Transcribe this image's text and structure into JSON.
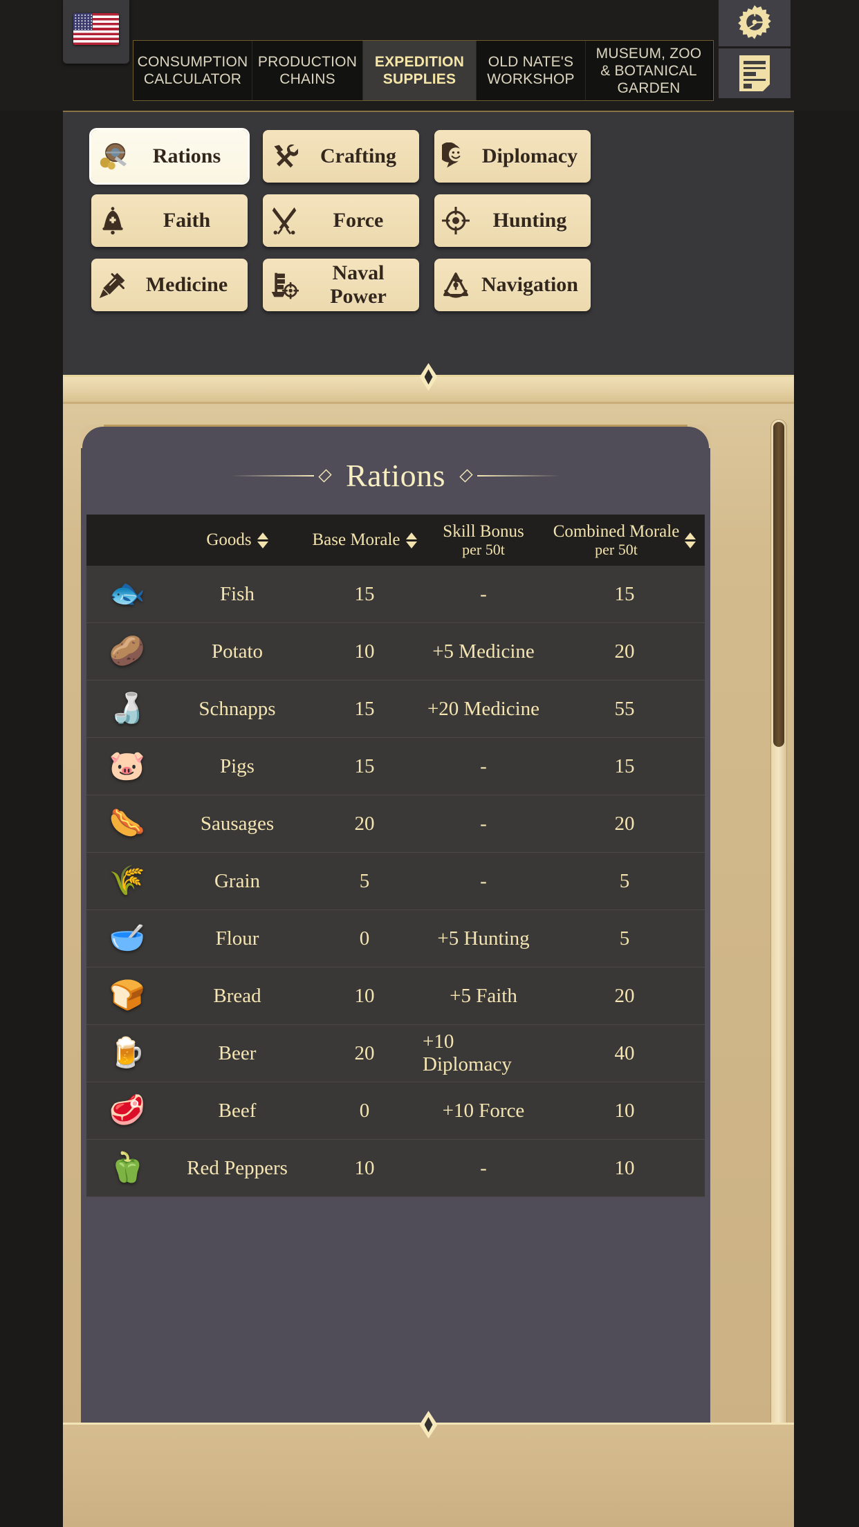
{
  "header": {
    "flag_icon": "us-flag-icon",
    "tabs": [
      {
        "label": "CONSUMPTION\nCALCULATOR",
        "line1": "CONSUMPTION",
        "line2": "CALCULATOR",
        "active": false
      },
      {
        "label": "PRODUCTION\nCHAINS",
        "line1": "PRODUCTION",
        "line2": "CHAINS",
        "active": false
      },
      {
        "label": "EXPEDITION\nSUPPLIES",
        "line1": "EXPEDITION",
        "line2": "SUPPLIES",
        "active": true
      },
      {
        "label": "OLD NATE'S\nWORKSHOP",
        "line1": "OLD NATE'S",
        "line2": "WORKSHOP",
        "active": false
      },
      {
        "label": "MUSEUM, ZOO\n& BOTANICAL\nGARDEN",
        "line1": "MUSEUM, ZOO",
        "line2": "& BOTANICAL",
        "line3": "GARDEN",
        "active": false
      }
    ],
    "system_buttons": [
      {
        "name": "settings-gear-icon"
      },
      {
        "name": "notes-document-icon"
      }
    ]
  },
  "categories": [
    {
      "label": "Rations",
      "icon": "barrel-rations-icon",
      "selected": true
    },
    {
      "label": "Crafting",
      "icon": "hammer-wrench-icon",
      "selected": false
    },
    {
      "label": "Diplomacy",
      "icon": "speech-smiley-icon",
      "selected": false
    },
    {
      "label": "Faith",
      "icon": "bell-icon",
      "selected": false
    },
    {
      "label": "Force",
      "icon": "crossed-swords-icon",
      "selected": false
    },
    {
      "label": "Hunting",
      "icon": "crosshair-icon",
      "selected": false
    },
    {
      "label": "Medicine",
      "icon": "syringe-icon",
      "selected": false
    },
    {
      "label": "Naval Power",
      "icon": "ship-target-icon",
      "selected": false
    },
    {
      "label": "Navigation",
      "icon": "sextant-icon",
      "selected": false
    }
  ],
  "panel": {
    "title": "Rations",
    "columns": [
      {
        "key": "icon",
        "label": "",
        "sub": "",
        "sortable": false
      },
      {
        "key": "goods",
        "label": "Goods",
        "sub": "",
        "sortable": true
      },
      {
        "key": "base",
        "label": "Base Morale",
        "sub": "",
        "sortable": true
      },
      {
        "key": "skill",
        "label": "Skill Bonus",
        "sub": "per 50t",
        "sortable": false
      },
      {
        "key": "combined",
        "label": "Combined Morale",
        "sub": "per 50t",
        "sortable": true
      }
    ],
    "rows": [
      {
        "icon": "fish-icon",
        "goods": "Fish",
        "base": "15",
        "skill": "-",
        "combined": "15"
      },
      {
        "icon": "potato-icon",
        "goods": "Potato",
        "base": "10",
        "skill": "+5 Medicine",
        "combined": "20"
      },
      {
        "icon": "schnapps-icon",
        "goods": "Schnapps",
        "base": "15",
        "skill": "+20 Medicine",
        "combined": "55"
      },
      {
        "icon": "pig-icon",
        "goods": "Pigs",
        "base": "15",
        "skill": "-",
        "combined": "15"
      },
      {
        "icon": "sausage-icon",
        "goods": "Sausages",
        "base": "20",
        "skill": "-",
        "combined": "20"
      },
      {
        "icon": "grain-icon",
        "goods": "Grain",
        "base": "5",
        "skill": "-",
        "combined": "5"
      },
      {
        "icon": "flour-sack-icon",
        "goods": "Flour",
        "base": "0",
        "skill": "+5 Hunting",
        "combined": "5"
      },
      {
        "icon": "bread-icon",
        "goods": "Bread",
        "base": "10",
        "skill": "+5 Faith",
        "combined": "20"
      },
      {
        "icon": "beer-icon",
        "goods": "Beer",
        "base": "20",
        "skill": "+10 Diplomacy",
        "combined": "40"
      },
      {
        "icon": "beef-icon",
        "goods": "Beef",
        "base": "0",
        "skill": "+10 Force",
        "combined": "10"
      },
      {
        "icon": "red-pepper-icon",
        "goods": "Red Peppers",
        "base": "10",
        "skill": "-",
        "combined": "10"
      }
    ]
  },
  "colors": {
    "gold_text": "#f4e5b2",
    "panel_bg": "#504c58",
    "row_bg": "#3b3937",
    "header_row_bg": "#211f1d",
    "button_cream": "#f0dfb6",
    "wood": "#d3bb8d",
    "accent_border": "#8a7443"
  }
}
